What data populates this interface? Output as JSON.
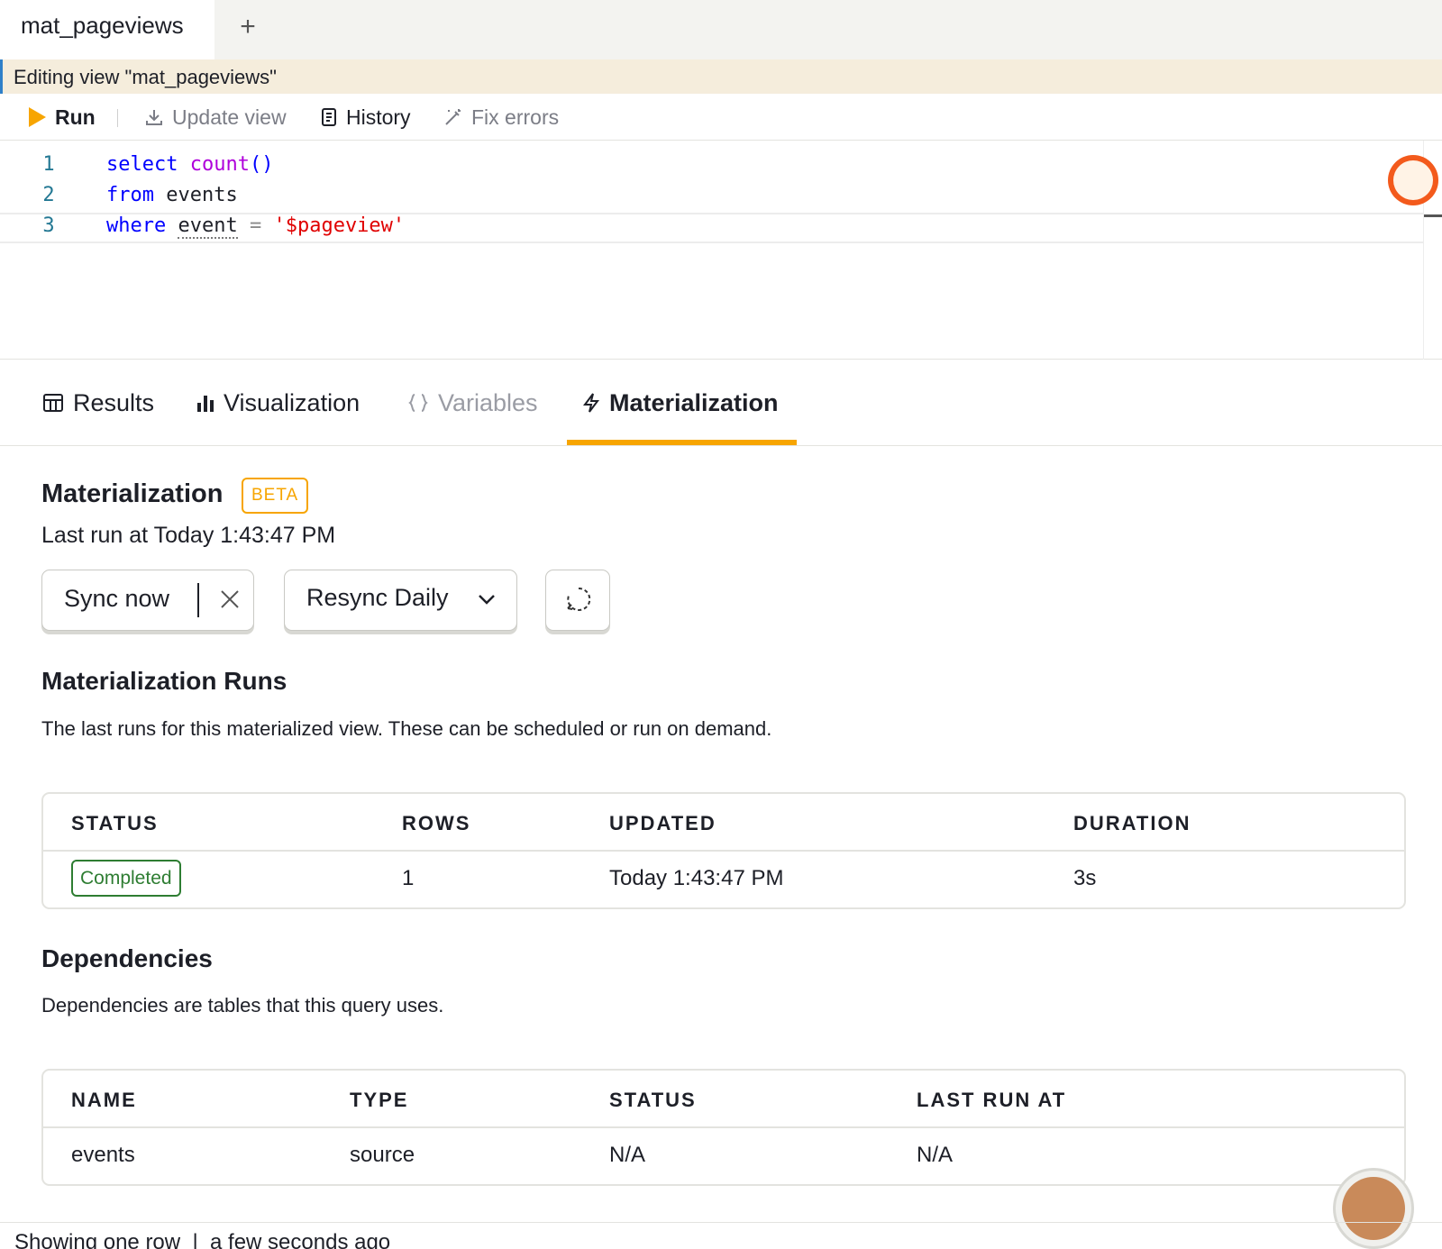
{
  "tabs": {
    "active_label": "mat_pageviews",
    "add_label": "+"
  },
  "banner": {
    "text": "Editing view \"mat_pageviews\""
  },
  "toolbar": {
    "run_label": "Run",
    "update_label": "Update view",
    "history_label": "History",
    "fix_label": "Fix errors"
  },
  "editor": {
    "lines": [
      {
        "number": "1",
        "tokens": [
          {
            "t": "select",
            "c": "kw"
          },
          {
            "t": " ",
            "c": "plain"
          },
          {
            "t": "count",
            "c": "fn"
          },
          {
            "t": "()",
            "c": "kw"
          }
        ]
      },
      {
        "number": "2",
        "tokens": [
          {
            "t": "from",
            "c": "kw"
          },
          {
            "t": " events",
            "c": "plain"
          }
        ]
      },
      {
        "number": "3",
        "tokens": [
          {
            "t": "where",
            "c": "kw"
          },
          {
            "t": " ",
            "c": "plain"
          },
          {
            "t": "event",
            "c": "plain squiggle"
          },
          {
            "t": " ",
            "c": "plain"
          },
          {
            "t": "=",
            "c": "op"
          },
          {
            "t": " ",
            "c": "plain"
          },
          {
            "t": "'$pageview'",
            "c": "str"
          }
        ]
      }
    ]
  },
  "result_tabs": {
    "results": "Results",
    "visualization": "Visualization",
    "variables": "Variables",
    "materialization": "Materialization"
  },
  "materialization": {
    "title": "Materialization",
    "badge": "BETA",
    "last_run": "Last run at Today 1:43:47 PM",
    "sync_label": "Sync now",
    "resync_label": "Resync Daily"
  },
  "runs": {
    "title": "Materialization Runs",
    "description": "The last runs for this materialized view. These can be scheduled or run on demand.",
    "columns": [
      "STATUS",
      "ROWS",
      "UPDATED",
      "DURATION"
    ],
    "rows": [
      {
        "status": "Completed",
        "rows": "1",
        "updated": "Today 1:43:47 PM",
        "duration": "3s"
      }
    ]
  },
  "dependencies": {
    "title": "Dependencies",
    "description": "Dependencies are tables that this query uses.",
    "columns": [
      "NAME",
      "TYPE",
      "STATUS",
      "LAST RUN AT"
    ],
    "rows": [
      {
        "name": "events",
        "type": "source",
        "status": "N/A",
        "last_run_at": "N/A"
      }
    ]
  },
  "footer": {
    "text": "Showing one row  |  a few seconds ago"
  },
  "colors": {
    "accent": "#f7a501",
    "success": "#2e7d32",
    "link_blue": "#2f80c9"
  }
}
